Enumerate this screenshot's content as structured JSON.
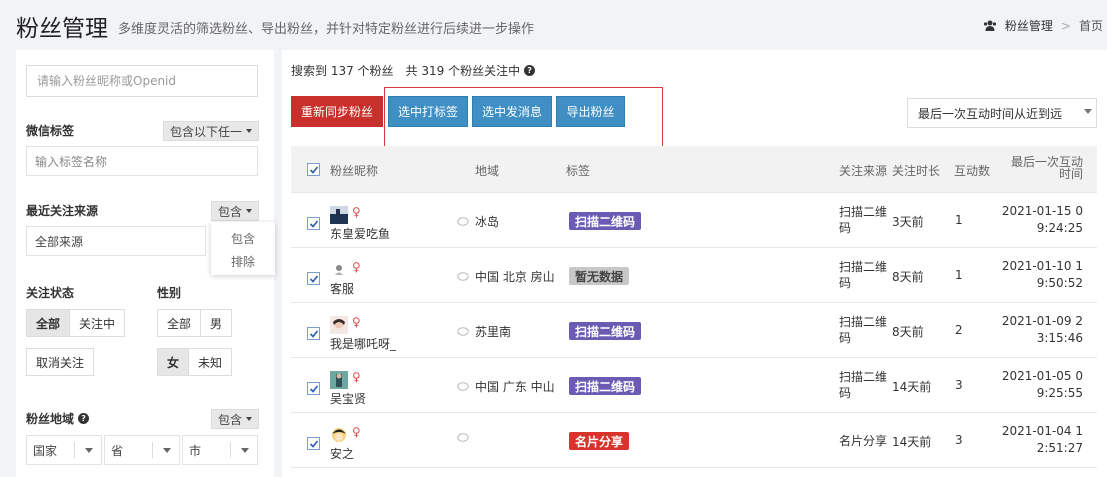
{
  "header": {
    "title": "粉丝管理",
    "subtitle": "多维度灵活的筛选粉丝、导出粉丝，并针对特定粉丝进行后续进一步操作",
    "breadcrumb_current": "粉丝管理",
    "breadcrumb_home": "首页"
  },
  "sidebar": {
    "search_placeholder": "请输入粉丝昵称或Openid",
    "wechat_tag_label": "微信标签",
    "wechat_tag_mode": "包含以下任一",
    "tag_input_placeholder": "输入标签名称",
    "source_label": "最近关注来源",
    "source_mode": "包含",
    "source_value": "全部来源",
    "source_popup": [
      "包含",
      "排除"
    ],
    "follow_status_label": "关注状态",
    "follow_status_options": [
      "全部",
      "关注中",
      "取消关注"
    ],
    "follow_status_active": "全部",
    "gender_label": "性别",
    "gender_options": [
      "全部",
      "男",
      "女",
      "未知"
    ],
    "gender_active": "女",
    "region_label": "粉丝地域",
    "region_mode": "包含",
    "region_selects": [
      "国家",
      "省",
      "市"
    ]
  },
  "main": {
    "summary_prefix": "搜索到 137 个粉丝",
    "summary_total": "共 319 个粉丝关注中",
    "buttons": {
      "resync": "重新同步粉丝",
      "tag_selected": "选中打标签",
      "message_selected": "选中发消息",
      "export": "导出粉丝"
    },
    "sort_value": "最后一次互动时间从近到远",
    "columns": {
      "nickname": "粉丝昵称",
      "region": "地域",
      "tags": "标签",
      "source": "关注来源",
      "duration": "关注时长",
      "interactions": "互动数",
      "last_interaction": "最后一次互动时间"
    },
    "rows": [
      {
        "nickname": "东皇爱吃鱼",
        "gender": "♀",
        "region": "冰岛",
        "tag": "扫描二维码",
        "tag_color": "#6c5bb5",
        "source": "扫描二维码",
        "duration": "3天前",
        "interactions": "1",
        "last_time_1": "2021-01-15 0",
        "last_time_2": "9:24:25"
      },
      {
        "nickname": "客服",
        "gender": "♀",
        "region": "中国  北京  房山",
        "tag": "暂无数据",
        "tag_color": "#c8c8c8",
        "source": "扫描二维码",
        "duration": "8天前",
        "interactions": "1",
        "last_time_1": "2021-01-10 1",
        "last_time_2": "9:50:52"
      },
      {
        "nickname": "我是哪吒呀_",
        "gender": "♀",
        "region": "苏里南",
        "tag": "扫描二维码",
        "tag_color": "#6c5bb5",
        "source": "扫描二维码",
        "duration": "8天前",
        "interactions": "2",
        "last_time_1": "2021-01-09 2",
        "last_time_2": "3:15:46"
      },
      {
        "nickname": "吴宝贤",
        "gender": "♀",
        "region": "中国  广东  中山",
        "tag": "扫描二维码",
        "tag_color": "#6c5bb5",
        "source": "扫描二维码",
        "duration": "14天前",
        "interactions": "3",
        "last_time_1": "2021-01-05 0",
        "last_time_2": "9:25:55"
      },
      {
        "nickname": "安之",
        "gender": "♀",
        "region": "",
        "tag": "名片分享",
        "tag_color": "#d9342b",
        "source": "名片分享",
        "duration": "14天前",
        "interactions": "3",
        "last_time_1": "2021-01-04 1",
        "last_time_2": "2:51:27"
      }
    ]
  }
}
